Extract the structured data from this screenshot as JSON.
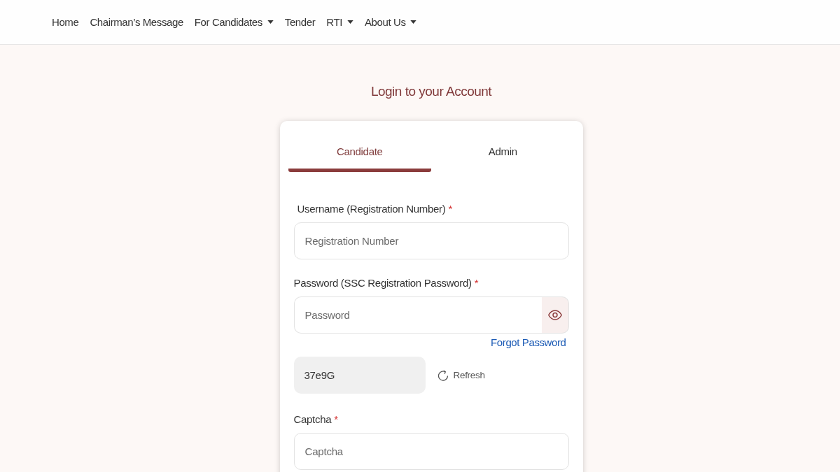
{
  "nav": [
    {
      "label": "Home",
      "dropdown": false
    },
    {
      "label": "Chairman’s Message",
      "dropdown": false
    },
    {
      "label": "For Candidates",
      "dropdown": true
    },
    {
      "label": "Tender",
      "dropdown": false
    },
    {
      "label": "RTI",
      "dropdown": true
    },
    {
      "label": "About Us",
      "dropdown": true
    }
  ],
  "title": "Login to your Account",
  "tabs": [
    {
      "label": "Candidate",
      "selected": true
    },
    {
      "label": "Admin",
      "selected": false
    }
  ],
  "form": {
    "username": {
      "label": "Username (Registration Number)",
      "required_mark": "*",
      "placeholder": "Registration Number"
    },
    "password": {
      "label": "Password (SSC Registration Password)",
      "required_mark": "*",
      "placeholder": "Password"
    },
    "forgot_password": "Forgot Password",
    "captcha_code": "37e9G",
    "refresh": "Refresh",
    "captcha": {
      "label": "Captcha",
      "required_mark": "*",
      "placeholder": "Captcha"
    }
  }
}
